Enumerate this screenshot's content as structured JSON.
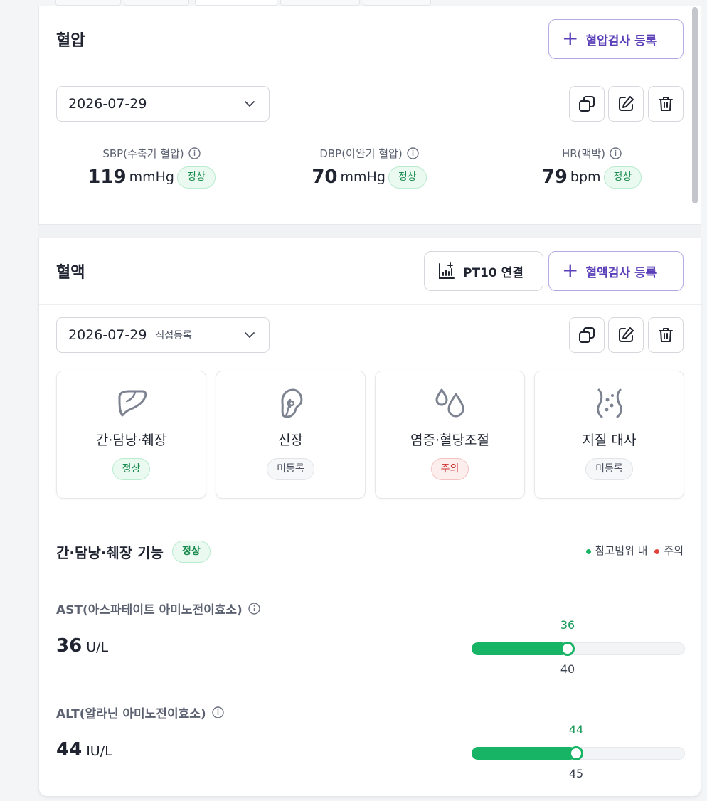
{
  "blood_pressure": {
    "title": "혈압",
    "register_label": "혈압검사 등록",
    "date": "2026-07-29",
    "vitals": [
      {
        "label": "SBP(수축기 혈압)",
        "value": "119",
        "unit": "mmHg",
        "status": "정상"
      },
      {
        "label": "DBP(이완기 혈압)",
        "value": "70",
        "unit": "mmHg",
        "status": "정상"
      },
      {
        "label": "HR(맥박)",
        "value": "79",
        "unit": "bpm",
        "status": "정상"
      }
    ]
  },
  "blood_test": {
    "title": "혈액",
    "link_label": "PT10 연결",
    "register_label": "혈액검사 등록",
    "date": "2026-07-29",
    "date_source": "직접등록",
    "categories": [
      {
        "label": "간·담낭·췌장",
        "status": "정상",
        "icon": "liver-icon"
      },
      {
        "label": "신장",
        "status": "미등록",
        "icon": "kidney-icon"
      },
      {
        "label": "염증·혈당조절",
        "status": "주의",
        "icon": "droplets-icon"
      },
      {
        "label": "지질 대사",
        "status": "미등록",
        "icon": "lipid-icon"
      }
    ],
    "section": {
      "title": "간·담낭·췌장 기능",
      "status": "정상",
      "legend": [
        {
          "label": "참고범위 내",
          "color": "#16b464"
        },
        {
          "label": "주의",
          "color": "#e0413a"
        }
      ],
      "metrics": [
        {
          "label": "AST(아스파테이트 아미노전이효소)",
          "value": "36",
          "unit": "U/L",
          "current": "36",
          "limit": "40",
          "fill_fraction": 0.45
        },
        {
          "label": "ALT(알라닌 아미노전이효소)",
          "value": "44",
          "unit": "IU/L",
          "current": "44",
          "limit": "45",
          "fill_fraction": 0.49
        }
      ]
    }
  },
  "colors": {
    "accent": "#5a3fb8",
    "normal": "#16b464",
    "warning": "#cc2f2f"
  }
}
